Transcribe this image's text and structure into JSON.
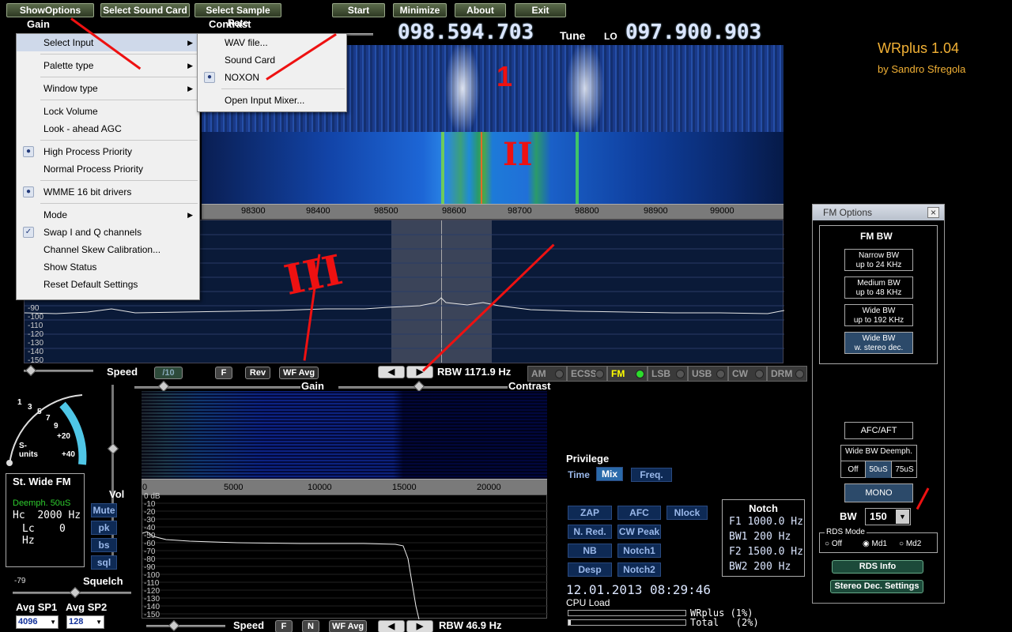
{
  "top_buttons": [
    "ShowOptions",
    "Select Sound Card",
    "Select Sample Rate",
    "Start",
    "Minimize",
    "About",
    "Exit"
  ],
  "labels": {
    "gain": "Gain",
    "contrast": "Contrast",
    "tune": "Tune",
    "lo": "LO"
  },
  "freq": {
    "tune": "098.594.703",
    "lo": "097.900.903"
  },
  "app": {
    "title": "WRplus 1.04",
    "author": "by Sandro Sfregola"
  },
  "menu": {
    "select_input": "Select Input",
    "palette_type": "Palette type",
    "window_type": "Window type",
    "lock_volume": "Lock Volume",
    "lookahead_agc": "Look - ahead AGC",
    "high_priority": "High Process Priority",
    "normal_priority": "Normal Process Priority",
    "wmme": "WMME 16 bit drivers",
    "mode": "Mode",
    "swap_iq": "Swap I and Q channels",
    "skew": "Channel Skew Calibration...",
    "show_status": "Show Status",
    "reset": "Reset Default Settings",
    "check_mark": "✓"
  },
  "submenu": {
    "wav": "WAV file...",
    "sound_card": "Sound Card",
    "noxon": "NOXON",
    "mixer": "Open Input Mixer..."
  },
  "spectrum": {
    "freq_ticks": [
      "98300",
      "98400",
      "98500",
      "98600",
      "98700",
      "98800",
      "98900",
      "99000"
    ],
    "db_ticks": [
      "-90",
      "-100",
      "-110",
      "-120",
      "-130",
      "-140",
      "-150"
    ]
  },
  "spec_controls": {
    "speed": "Speed",
    "speed_val": "/10",
    "f": "F",
    "rev": "Rev",
    "wf_avg": "WF Avg",
    "rbw": "RBW 1171.9 Hz",
    "gain": "Gain",
    "contrast": "Contrast"
  },
  "modes": [
    "AM",
    "ECSS",
    "FM",
    "LSB",
    "USB",
    "CW",
    "DRM"
  ],
  "smeter": {
    "ticks": [
      "1",
      "3",
      "5",
      "7",
      "9",
      "+20",
      "+40"
    ],
    "label": "S-units"
  },
  "st_panel": {
    "title": "St. Wide FM",
    "deemph": "Deemph. 50uS",
    "hc_label": "Hc",
    "hc_val": "2000 Hz",
    "lc_label": "Lc",
    "lc_val": "0 Hz"
  },
  "vol": {
    "label": "Vol",
    "buttons": [
      "Mute",
      "pk",
      "bs",
      "sql"
    ]
  },
  "squelch": {
    "value": "-79",
    "label": "Squelch"
  },
  "avg": {
    "sp1_label": "Avg SP1",
    "sp2_label": "Avg SP2",
    "sp1": "4096",
    "sp2": "128"
  },
  "audio": {
    "freq_ticks": [
      "0",
      "5000",
      "10000",
      "15000",
      "20000"
    ],
    "db_ticks": [
      "0 dB",
      "-10",
      "-20",
      "-30",
      "-40",
      "-50",
      "-60",
      "-70",
      "-80",
      "-90",
      "-100",
      "-110",
      "-120",
      "-130",
      "-140",
      "-150"
    ],
    "speed": "Speed",
    "f": "F",
    "n": "N",
    "wf_avg": "WF Avg",
    "rbw": "RBW 46.9 Hz"
  },
  "privilege": {
    "label": "Privilege",
    "options": [
      "Time",
      "Mix",
      "Freq."
    ]
  },
  "dsp_buttons": [
    "ZAP",
    "AFC",
    "Nlock",
    "N. Red.",
    "CW Peak",
    "NB",
    "Notch1",
    "Desp",
    "Notch2"
  ],
  "notch": {
    "title": "Notch",
    "lines": [
      "F1 1000.0 Hz",
      "BW1  200 Hz",
      "F2 1500.0 Hz",
      "BW2  200 Hz"
    ]
  },
  "status": {
    "datetime": "12.01.2013 08:29:46",
    "cpu_load": "CPU Load",
    "wrplus": "WRplus (1%)",
    "total": "Total   (2%)"
  },
  "fm_options": {
    "title": "FM Options",
    "close": "×",
    "section": "FM BW",
    "bw_buttons": [
      {
        "line1": "Narrow BW",
        "line2": "up to 24 KHz"
      },
      {
        "line1": "Medium BW",
        "line2": "up to 48 KHz"
      },
      {
        "line1": "Wide BW",
        "line2": "up to 192 KHz"
      },
      {
        "line1": "Wide BW",
        "line2": "w. stereo dec."
      }
    ],
    "afc": "AFC/AFT",
    "deemph_title": "Wide BW Deemph.",
    "deemph_options": [
      "Off",
      "50uS",
      "75uS"
    ],
    "mono": "MONO",
    "bw_label": "BW",
    "bw_value": "150",
    "rds_mode": "RDS Mode",
    "rds_options": [
      "Off",
      "Md1",
      "Md2"
    ],
    "rds_info": "RDS Info",
    "stereo_settings": "Stereo Dec. Settings"
  },
  "annotations": {
    "one": "1",
    "two": "II",
    "three": "III"
  }
}
